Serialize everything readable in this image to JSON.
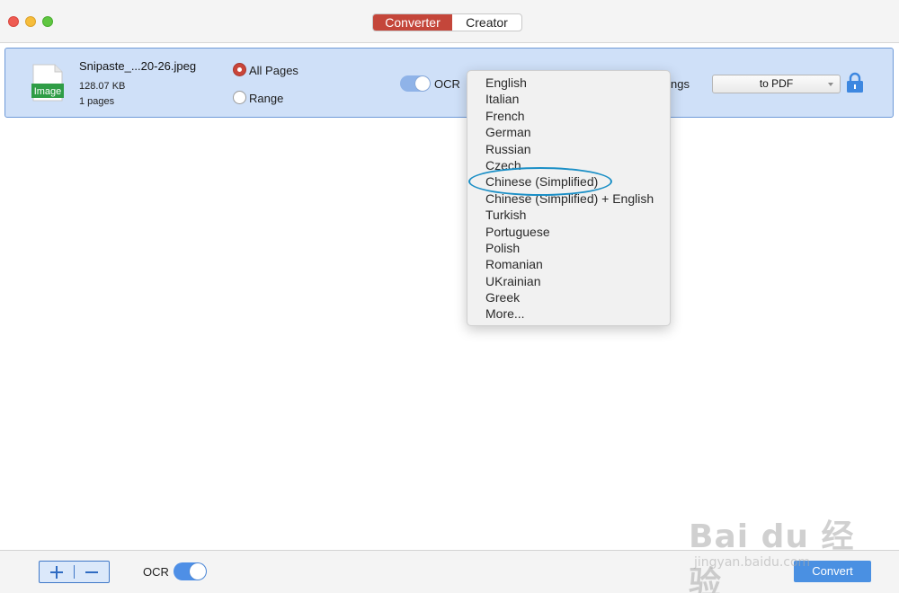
{
  "window": {
    "tabs": [
      {
        "label": "Converter",
        "active": true
      },
      {
        "label": "Creator",
        "active": false
      }
    ]
  },
  "file": {
    "icon_label": "Image",
    "name": "Snipaste_...20-26.jpeg",
    "size": "128.07 KB",
    "pages": "1 pages",
    "page_options": {
      "all": "All Pages",
      "range": "Range",
      "selected": "all"
    },
    "ocr_label": "OCR",
    "ocr_enabled": true,
    "settings_label_partial": "ngs",
    "output_format": "to PDF"
  },
  "ocr_language_menu": {
    "items": [
      "English",
      "Italian",
      "French",
      "German",
      "Russian",
      "Czech",
      "Chinese (Simplified)",
      "Chinese (Simplified) + English",
      "Turkish",
      "Portuguese",
      "Polish",
      "Romanian",
      "UKrainian",
      "Greek",
      "More..."
    ],
    "highlighted": "Chinese (Simplified)"
  },
  "bottom": {
    "add_symbol": "+",
    "remove_symbol": "−",
    "ocr_label": "OCR",
    "ocr_enabled": true,
    "convert_label": "Convert"
  },
  "watermark": {
    "brand": "Bai du 经验",
    "url": "jingyan.baidu.com"
  },
  "colors": {
    "accent_red": "#c4463a",
    "selection_blue": "#cfe0f8",
    "button_blue": "#4a90e2",
    "highlight_ring": "#1b8fc6"
  }
}
